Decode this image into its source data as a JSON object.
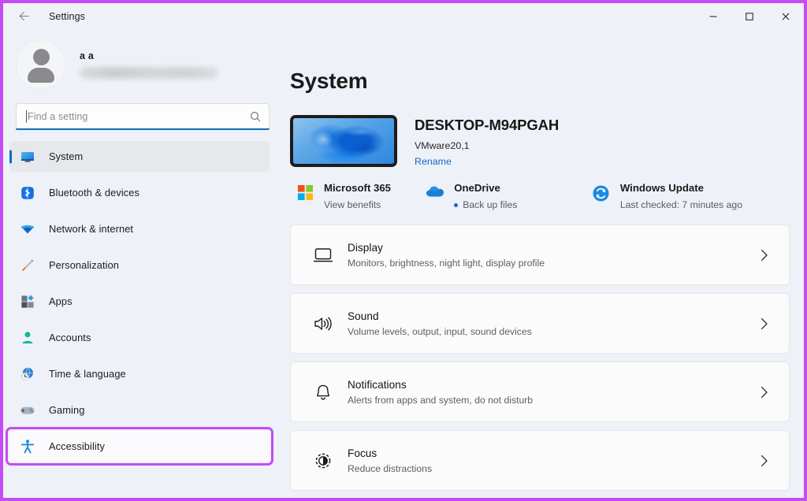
{
  "window": {
    "title": "Settings",
    "back_icon": "back-arrow-icon",
    "minimize_label": "–",
    "maximize_label": "□",
    "close_label": "✕",
    "accent_color": "#0f6cbd",
    "annotation_color": "#c44cf5"
  },
  "account": {
    "name": "a a",
    "email_redacted": ""
  },
  "search": {
    "placeholder": "Find a setting",
    "icon": "search-icon"
  },
  "sidebar": {
    "items": [
      {
        "label": "System",
        "icon": "monitor-icon",
        "selected": true
      },
      {
        "label": "Bluetooth & devices",
        "icon": "bluetooth-icon",
        "selected": false
      },
      {
        "label": "Network & internet",
        "icon": "wifi-icon",
        "selected": false
      },
      {
        "label": "Personalization",
        "icon": "paintbrush-icon",
        "selected": false
      },
      {
        "label": "Apps",
        "icon": "apps-icon",
        "selected": false
      },
      {
        "label": "Accounts",
        "icon": "person-icon",
        "selected": false
      },
      {
        "label": "Time & language",
        "icon": "clock-globe-icon",
        "selected": false
      },
      {
        "label": "Gaming",
        "icon": "gamepad-icon",
        "selected": false
      },
      {
        "label": "Accessibility",
        "icon": "accessibility-icon",
        "selected": false,
        "annotated": true
      }
    ]
  },
  "main": {
    "page_title": "System",
    "device": {
      "name": "DESKTOP-M94PGAH",
      "model": "VMware20,1",
      "rename_label": "Rename",
      "thumbnail": "windows-bloom-wallpaper"
    },
    "quick_links": [
      {
        "title": "Microsoft 365",
        "subtitle": "View benefits",
        "icon": "microsoft-logo-icon",
        "has_dot": false
      },
      {
        "title": "OneDrive",
        "subtitle": "Back up files",
        "icon": "onedrive-cloud-icon",
        "has_dot": true
      },
      {
        "title": "Windows Update",
        "subtitle": "Last checked: 7 minutes ago",
        "icon": "windows-update-icon",
        "has_dot": false
      }
    ],
    "cards": [
      {
        "title": "Display",
        "subtitle": "Monitors, brightness, night light, display profile",
        "icon": "display-monitor-icon"
      },
      {
        "title": "Sound",
        "subtitle": "Volume levels, output, input, sound devices",
        "icon": "speaker-icon"
      },
      {
        "title": "Notifications",
        "subtitle": "Alerts from apps and system, do not disturb",
        "icon": "bell-icon"
      },
      {
        "title": "Focus",
        "subtitle": "Reduce distractions",
        "icon": "focus-icon"
      }
    ],
    "chevron_icon": "chevron-right-icon"
  }
}
